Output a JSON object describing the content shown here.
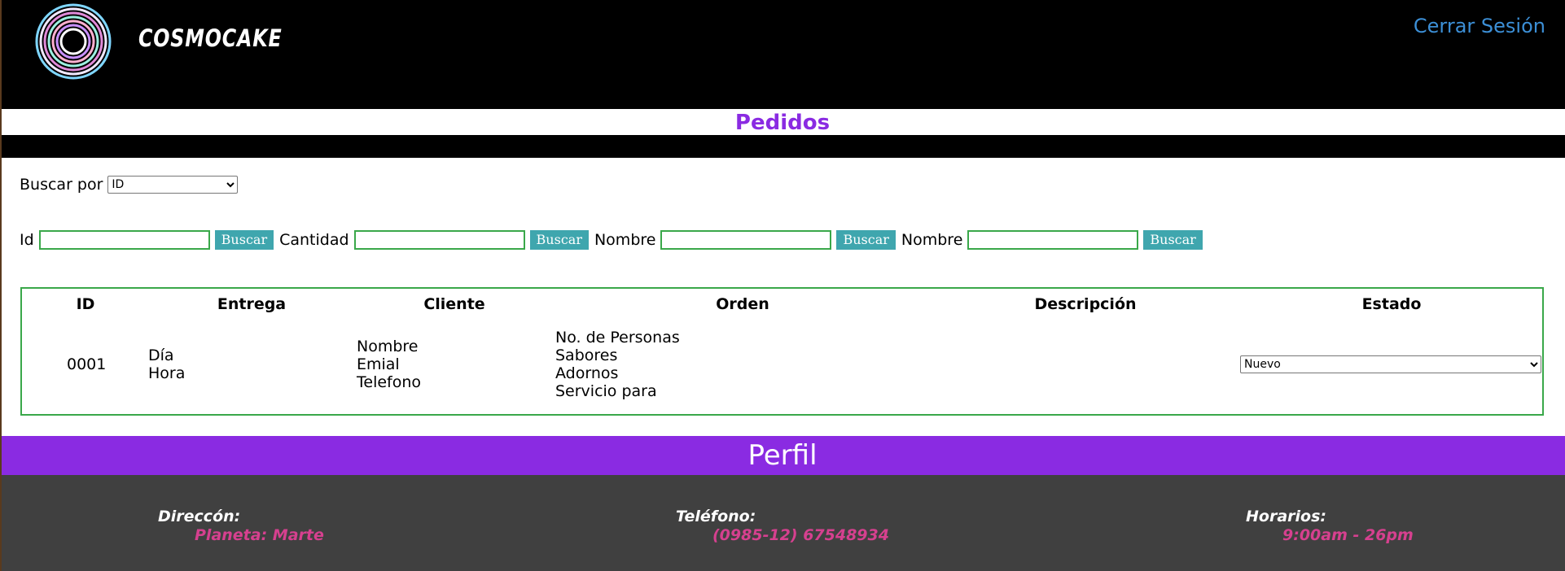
{
  "header": {
    "brand": "COSMOCAKE",
    "logout": "Cerrar Sesión"
  },
  "page_title": "Pedidos",
  "search_by": {
    "label": "Buscar por",
    "selected": "ID"
  },
  "search_fields": [
    {
      "label": "Id",
      "button": "Buscar"
    },
    {
      "label": "Cantidad",
      "button": "Buscar"
    },
    {
      "label": "Nombre",
      "button": "Buscar"
    },
    {
      "label": "Nombre",
      "button": "Buscar"
    }
  ],
  "table": {
    "headers": [
      "ID",
      "Entrega",
      "Cliente",
      "Orden",
      "Descripción",
      "Estado"
    ],
    "rows": [
      {
        "id": "0001",
        "entrega": [
          "Día",
          "Hora"
        ],
        "cliente": [
          "Nombre",
          "Emial",
          "Telefono"
        ],
        "orden": [
          "No. de Personas",
          "Sabores",
          "Adornos",
          "Servicio para"
        ],
        "descripcion": "",
        "estado": "Nuevo"
      }
    ]
  },
  "profile": {
    "title": "Perfil",
    "direccion_label": "Direccón:",
    "direccion_value": "Planeta: Marte",
    "telefono_label": "Teléfono:",
    "telefono_value": "(0985-12) 67548934",
    "horarios_label": "Horarios:",
    "horarios_value": "9:00am - 26pm"
  },
  "colors": {
    "accent_purple": "#8a2be2",
    "button_teal": "#3fa6ae",
    "border_green": "#3aa84a",
    "link_blue": "#3c8fd6",
    "footer_pink": "#d6408f"
  }
}
